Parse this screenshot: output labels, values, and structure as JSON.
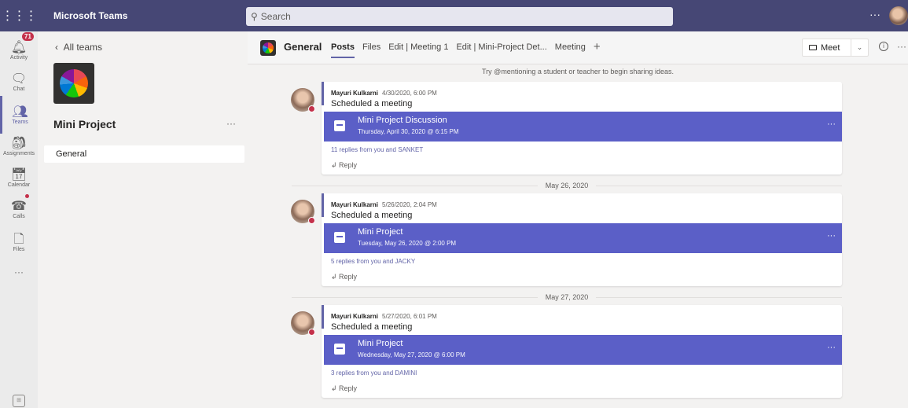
{
  "topbar": {
    "app_name": "Microsoft Teams",
    "search_placeholder": "Search",
    "more": "···"
  },
  "rail": {
    "activity": {
      "label": "Activity",
      "badge": "71"
    },
    "chat": {
      "label": "Chat"
    },
    "teams": {
      "label": "Teams"
    },
    "assignments": {
      "label": "Assignments"
    },
    "calendar": {
      "label": "Calendar"
    },
    "calls": {
      "label": "Calls"
    },
    "files": {
      "label": "Files"
    },
    "more": "···"
  },
  "team_panel": {
    "back_label": "All teams",
    "team_name": "Mini Project",
    "team_more": "···",
    "channels": [
      "General"
    ]
  },
  "channel_header": {
    "name": "General",
    "tabs": [
      "Posts",
      "Files",
      "Edit | Meeting 1",
      "Edit | Mini-Project Det...",
      "Meeting"
    ],
    "active_tab": "Posts",
    "add_tab": "+",
    "meet_label": "Meet",
    "more": "···"
  },
  "feed": {
    "hint": "Try @mentioning a student or teacher to begin sharing ideas.",
    "posts": [
      {
        "author": "Mayuri Kulkarni",
        "timestamp": "4/30/2020, 6:00 PM",
        "text": "Scheduled a meeting",
        "meeting_title": "Mini Project Discussion",
        "meeting_time": "Thursday, April 30, 2020 @ 6:15 PM",
        "replies": "11 replies from you and SANKET",
        "reply_label": "Reply"
      },
      {
        "author": "Mayuri Kulkarni",
        "timestamp": "5/26/2020, 2:04 PM",
        "text": "Scheduled a meeting",
        "meeting_title": "Mini Project",
        "meeting_time": "Tuesday, May 26, 2020 @ 2:00 PM",
        "replies": "5 replies from you and JACKY",
        "reply_label": "Reply"
      },
      {
        "author": "Mayuri Kulkarni",
        "timestamp": "5/27/2020, 6:01 PM",
        "text": "Scheduled a meeting",
        "meeting_title": "Mini Project",
        "meeting_time": "Wednesday, May 27, 2020 @ 6:00 PM",
        "replies": "3 replies from you and DAMINI",
        "reply_label": "Reply"
      }
    ],
    "date_separators": [
      "May 26, 2020",
      "May 27, 2020"
    ]
  },
  "colors": {
    "topbar": "#464775",
    "accent": "#6264a7",
    "meeting_card": "#5b5fc7",
    "badge": "#c4314b"
  }
}
